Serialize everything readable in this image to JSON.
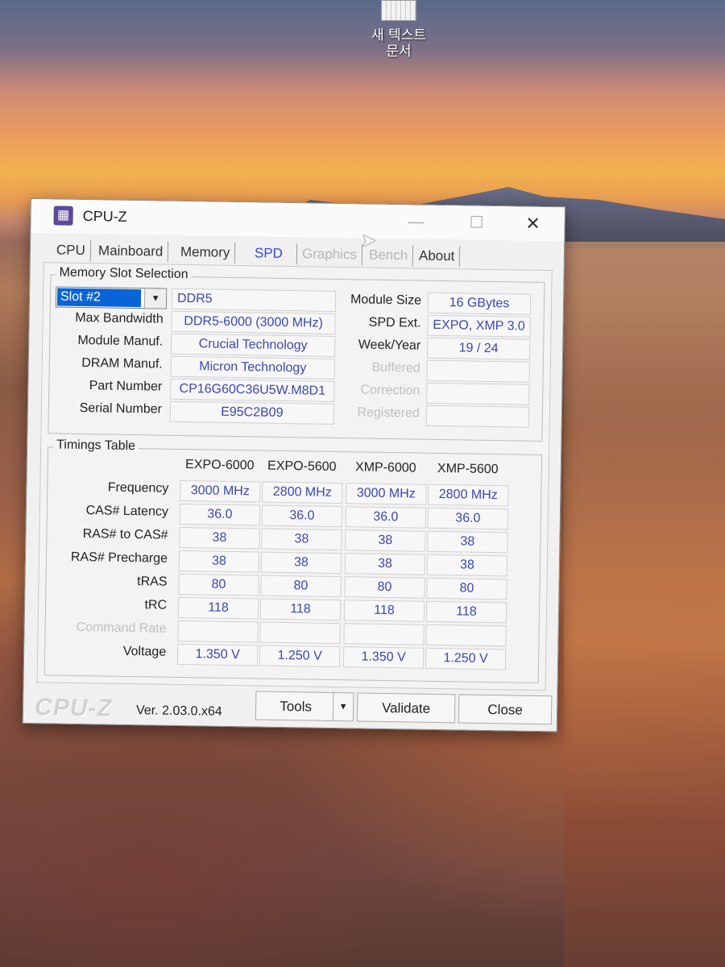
{
  "desktop": {
    "icon_label_line1": "새 텍스트",
    "icon_label_line2": "문서"
  },
  "window": {
    "title": "CPU-Z",
    "controls": {
      "minimize": "—",
      "maximize": "☐",
      "close": "✕"
    }
  },
  "tabs": [
    "CPU",
    "Mainboard",
    "Memory",
    "SPD",
    "Graphics",
    "Bench",
    "About"
  ],
  "active_tab": "SPD",
  "memory_slot": {
    "group_title": "Memory Slot Selection",
    "slot_selected": "Slot #2",
    "type": "DDR5",
    "labels": {
      "max_bandwidth": "Max Bandwidth",
      "module_manuf": "Module Manuf.",
      "dram_manuf": "DRAM Manuf.",
      "part_number": "Part Number",
      "serial_number": "Serial Number",
      "module_size": "Module Size",
      "spd_ext": "SPD Ext.",
      "week_year": "Week/Year",
      "buffered": "Buffered",
      "correction": "Correction",
      "registered": "Registered"
    },
    "values": {
      "max_bandwidth": "DDR5-6000 (3000 MHz)",
      "module_manuf": "Crucial Technology",
      "dram_manuf": "Micron Technology",
      "part_number": "CP16G60C36U5W.M8D1",
      "serial_number": "E95C2B09",
      "module_size": "16 GBytes",
      "spd_ext": "EXPO, XMP 3.0",
      "week_year": "19 / 24",
      "buffered": "",
      "correction": "",
      "registered": ""
    }
  },
  "timings": {
    "group_title": "Timings Table",
    "columns": [
      "EXPO-6000",
      "EXPO-5600",
      "XMP-6000",
      "XMP-5600"
    ],
    "rows": [
      {
        "label": "Frequency",
        "values": [
          "3000 MHz",
          "2800 MHz",
          "3000 MHz",
          "2800 MHz"
        ]
      },
      {
        "label": "CAS# Latency",
        "values": [
          "36.0",
          "36.0",
          "36.0",
          "36.0"
        ]
      },
      {
        "label": "RAS# to CAS#",
        "values": [
          "38",
          "38",
          "38",
          "38"
        ]
      },
      {
        "label": "RAS# Precharge",
        "values": [
          "38",
          "38",
          "38",
          "38"
        ]
      },
      {
        "label": "tRAS",
        "values": [
          "80",
          "80",
          "80",
          "80"
        ]
      },
      {
        "label": "tRC",
        "values": [
          "118",
          "118",
          "118",
          "118"
        ]
      },
      {
        "label": "Command Rate",
        "values": [
          "",
          "",
          "",
          ""
        ]
      },
      {
        "label": "Voltage",
        "values": [
          "1.350 V",
          "1.250 V",
          "1.350 V",
          "1.250 V"
        ]
      }
    ]
  },
  "footer": {
    "brand": "CPU-Z",
    "version": "Ver. 2.03.0.x64",
    "tools_label": "Tools",
    "validate_label": "Validate",
    "close_label": "Close"
  }
}
